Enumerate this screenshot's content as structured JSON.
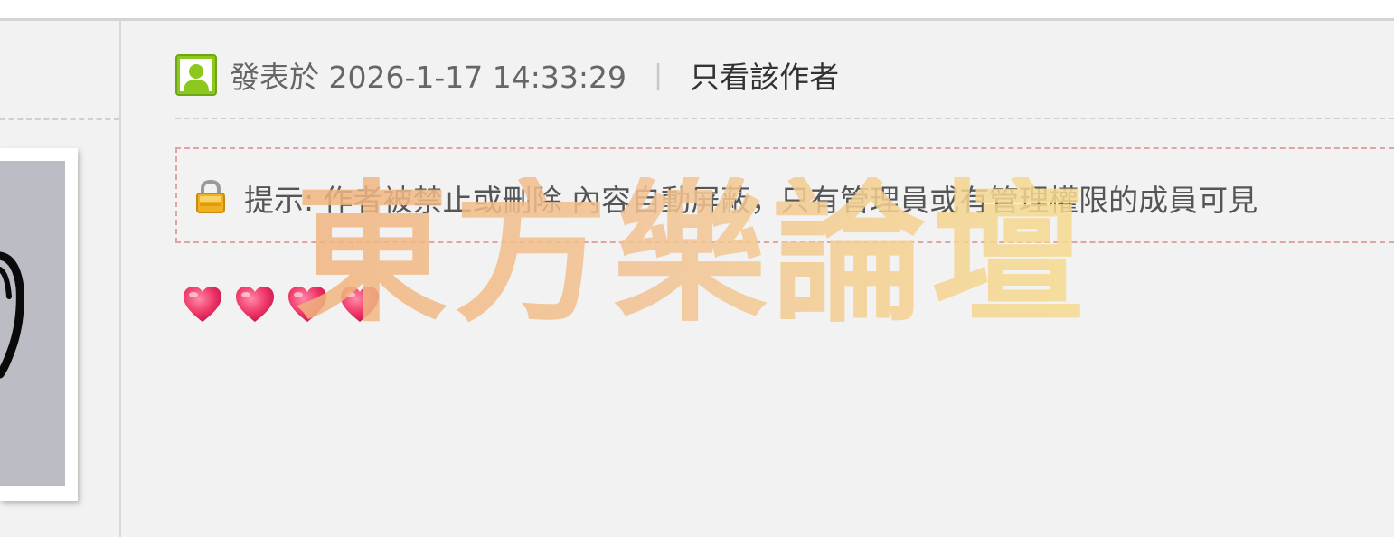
{
  "post": {
    "timestamp": "發表於 2026-1-17 14:33:29",
    "separator": "|",
    "only_author_link": "只看該作者"
  },
  "notice": {
    "text": "提示: 作者被禁止或刪除 內容自動屏蔽，只有管理員或有管理權限的成員可見",
    "border_color": "#e2a3a3",
    "icon": "lock-icon"
  },
  "reactions": {
    "icon": "heart-icon",
    "count": 4
  },
  "watermark": {
    "text": "東方樂論壇",
    "colors": [
      "#f0b47e",
      "#f6dc8f"
    ]
  },
  "icons": {
    "user": "user-icon",
    "lock": "lock-icon",
    "heart": "heart-icon"
  },
  "colors": {
    "background": "#f2f2f2",
    "user_icon": "#8cc81e",
    "lock_icon": "#f0b020",
    "heart": "#e8305c"
  }
}
